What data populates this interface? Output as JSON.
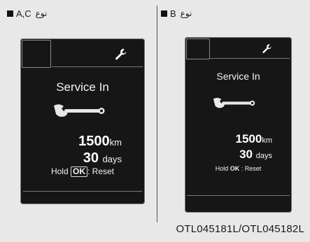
{
  "panels": [
    {
      "type_label": "نوع",
      "type_code": "A,C",
      "title": "Service In",
      "distance_value": "1500",
      "distance_unit": "km",
      "days_value": "30",
      "days_unit": "days",
      "hold_text": "Hold",
      "ok_label": "OK",
      "reset_text": ": Reset"
    },
    {
      "type_label": "نوع",
      "type_code": "B",
      "title": "Service In",
      "distance_value": "1500",
      "distance_unit": "km",
      "days_value": "30",
      "days_unit": "days",
      "hold_text": "Hold",
      "ok_label": "OK",
      "reset_text": " : Reset"
    }
  ],
  "caption": "OTL045181L/OTL045182L",
  "icons": {
    "wrench_small": "wrench-icon",
    "wrench_large": "wrench-icon"
  }
}
